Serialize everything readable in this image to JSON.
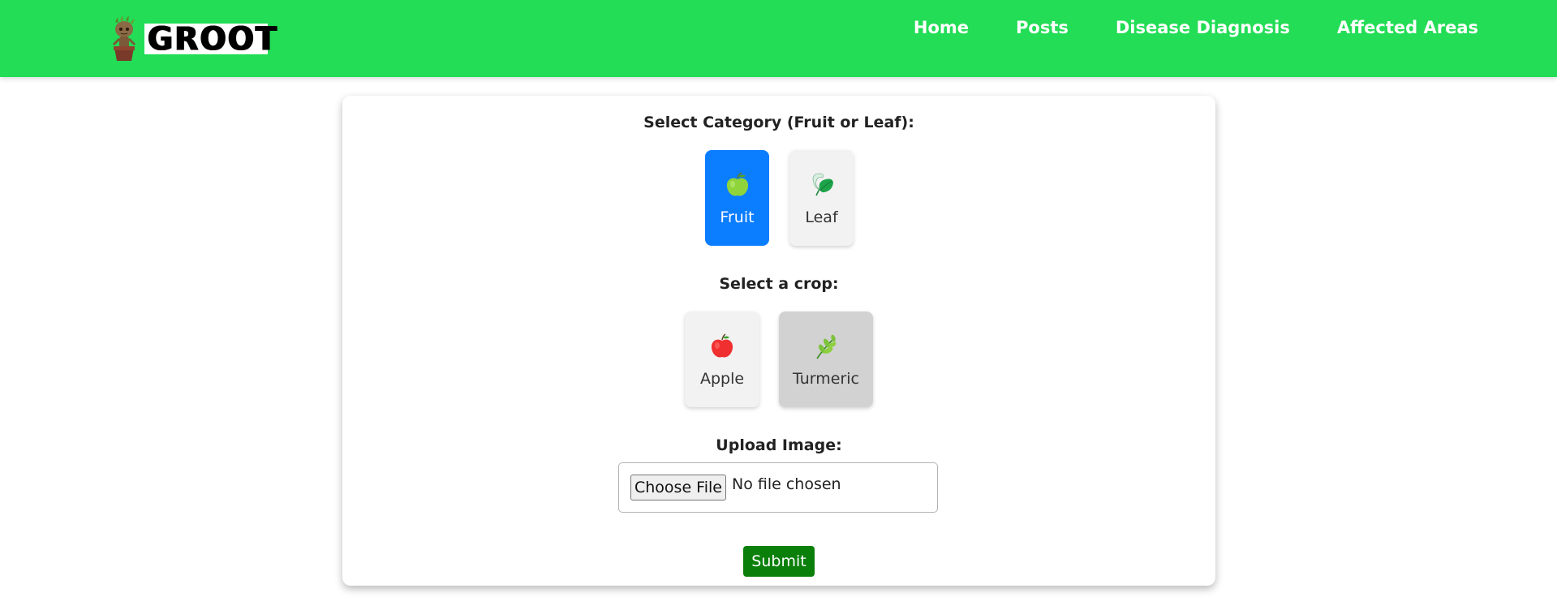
{
  "header": {
    "logo_text": "GROOT",
    "nav": [
      "Home",
      "Posts",
      "Disease Diagnosis",
      "Affected Areas"
    ]
  },
  "form": {
    "category_label": "Select Category (Fruit or Leaf):",
    "categories": [
      {
        "label": "Fruit",
        "icon": "green-apple-icon",
        "selected": true
      },
      {
        "label": "Leaf",
        "icon": "leaf-icon",
        "selected": false
      }
    ],
    "crop_label": "Select a crop:",
    "crops": [
      {
        "label": "Apple",
        "icon": "red-apple-icon",
        "selected": false
      },
      {
        "label": "Turmeric",
        "icon": "herb-icon",
        "selected": false
      }
    ],
    "upload_label": "Upload Image:",
    "file_button": "Choose File",
    "file_status": "No file chosen",
    "submit": "Submit"
  },
  "colors": {
    "navbar": "#22dd55",
    "selected": "#0b7dff",
    "submit": "#0a7f0a"
  }
}
